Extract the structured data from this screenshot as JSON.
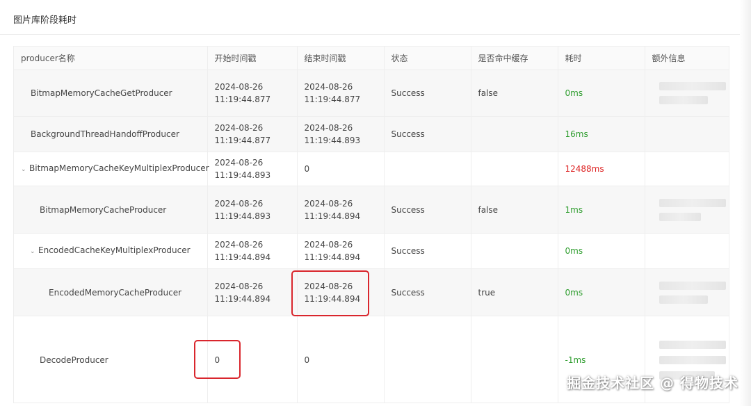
{
  "panel": {
    "title": "图片库阶段耗时"
  },
  "table": {
    "columns": [
      "producer名称",
      "开始时间戳",
      "结束时间戳",
      "状态",
      "是否命中缓存",
      "耗时",
      "额外信息"
    ],
    "rows": [
      {
        "name": "BitmapMemoryCacheGetProducer",
        "indent": 0,
        "chevron": false,
        "start_date": "2024-08-26",
        "start_time": "11:19:44.877",
        "end_date": "2024-08-26",
        "end_time": "11:19:44.877",
        "end_single": "",
        "status": "Success",
        "cache": "false",
        "duration": "0ms",
        "duration_state": "ok"
      },
      {
        "name": "BackgroundThreadHandoffProducer",
        "indent": 0,
        "chevron": false,
        "start_date": "2024-08-26",
        "start_time": "11:19:44.877",
        "end_date": "2024-08-26",
        "end_time": "11:19:44.893",
        "end_single": "",
        "status": "Success",
        "cache": "",
        "duration": "16ms",
        "duration_state": "ok"
      },
      {
        "name": "BitmapMemoryCacheKeyMultiplexProducer",
        "indent": 0,
        "chevron": true,
        "start_date": "2024-08-26",
        "start_time": "11:19:44.893",
        "end_date": "",
        "end_time": "",
        "end_single": "0",
        "status": "",
        "cache": "",
        "duration": "12488ms",
        "duration_state": "bad"
      },
      {
        "name": "BitmapMemoryCacheProducer",
        "indent": 1,
        "chevron": false,
        "start_date": "2024-08-26",
        "start_time": "11:19:44.893",
        "end_date": "2024-08-26",
        "end_time": "11:19:44.894",
        "end_single": "",
        "status": "Success",
        "cache": "false",
        "duration": "1ms",
        "duration_state": "ok"
      },
      {
        "name": "EncodedCacheKeyMultiplexProducer",
        "indent": 1,
        "chevron": true,
        "start_date": "2024-08-26",
        "start_time": "11:19:44.894",
        "end_date": "2024-08-26",
        "end_time": "11:19:44.894",
        "end_single": "",
        "status": "Success",
        "cache": "",
        "duration": "0ms",
        "duration_state": "ok"
      },
      {
        "name": "EncodedMemoryCacheProducer",
        "indent": 2,
        "chevron": false,
        "start_date": "2024-08-26",
        "start_time": "11:19:44.894",
        "end_date": "2024-08-26",
        "end_time": "11:19:44.894",
        "end_single": "",
        "status": "Success",
        "cache": "true",
        "duration": "0ms",
        "duration_state": "ok"
      },
      {
        "name": "DecodeProducer",
        "indent": 1,
        "chevron": false,
        "start_date": "",
        "start_time": "",
        "start_single": "0",
        "end_date": "",
        "end_time": "",
        "end_single": "0",
        "status": "",
        "cache": "",
        "duration": "-1ms",
        "duration_state": "ok"
      }
    ]
  },
  "watermark": "掘金技术社区 @ 得物技术",
  "colors": {
    "success_green": "#2e9d2e",
    "error_red": "#d22222",
    "highlight_box": "#d9262d"
  }
}
